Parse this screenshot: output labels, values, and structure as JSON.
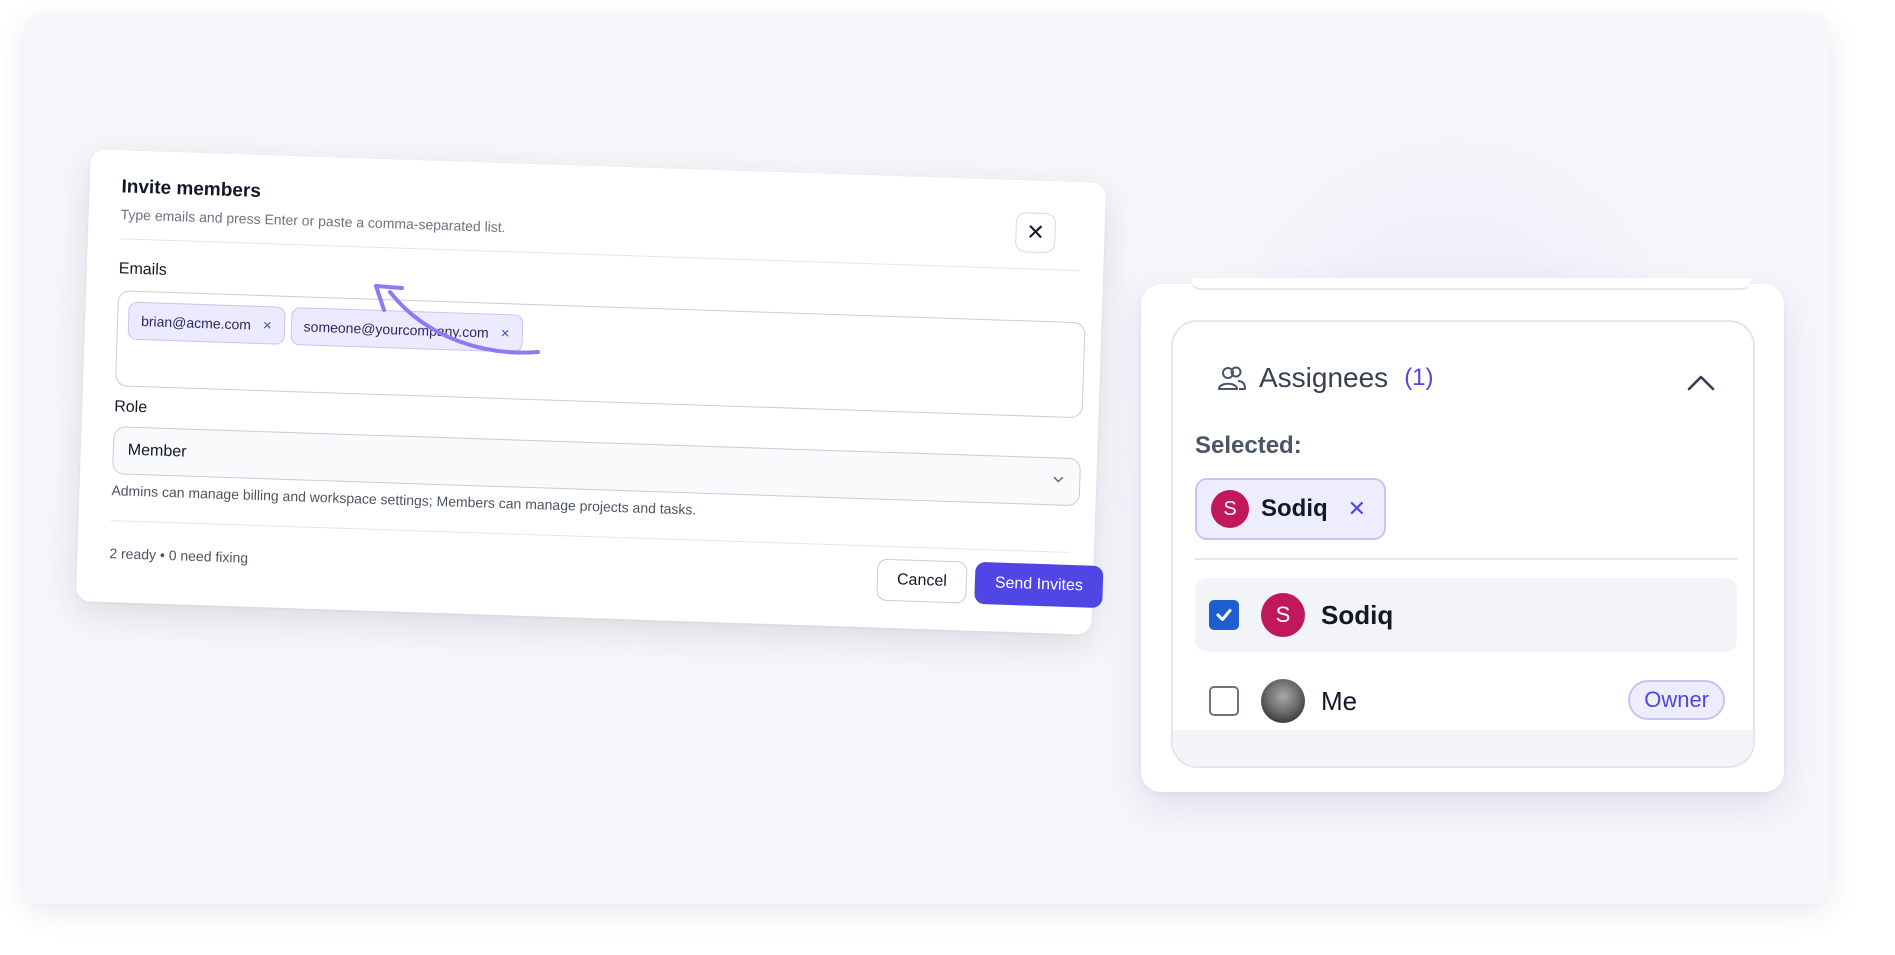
{
  "invite_dialog": {
    "title": "Invite members",
    "subtitle": "Type emails and press Enter or paste a comma-separated list.",
    "emails_label": "Emails",
    "email_chips": [
      {
        "email": "brian@acme.com",
        "remove": "×"
      },
      {
        "email": "someone@yourcompany.com",
        "remove": "×"
      }
    ],
    "role_label": "Role",
    "role_value": "Member",
    "role_help": "Admins can manage billing and workspace settings; Members can manage projects and tasks.",
    "status_text": "2 ready • 0 need fixing",
    "cancel_label": "Cancel",
    "send_label": "Send Invites",
    "close_glyph": "✕",
    "accent_color": "#4f46e5",
    "arrow_color": "#8b7cf6"
  },
  "assignees_panel": {
    "title": "Assignees",
    "count": "(1)",
    "selected_label": "Selected:",
    "selected_chip": {
      "initial": "S",
      "name": "Sodiq",
      "remove": "✕"
    },
    "rows": [
      {
        "initial": "S",
        "name": "Sodiq",
        "checked": true
      },
      {
        "name": "Me",
        "checked": false,
        "badge": "Owner"
      }
    ],
    "avatar_color": "#c0175d",
    "checkbox_color": "#1d5fd1",
    "icons": {
      "header": "users-icon",
      "toggle": "chevron-up-icon"
    }
  }
}
